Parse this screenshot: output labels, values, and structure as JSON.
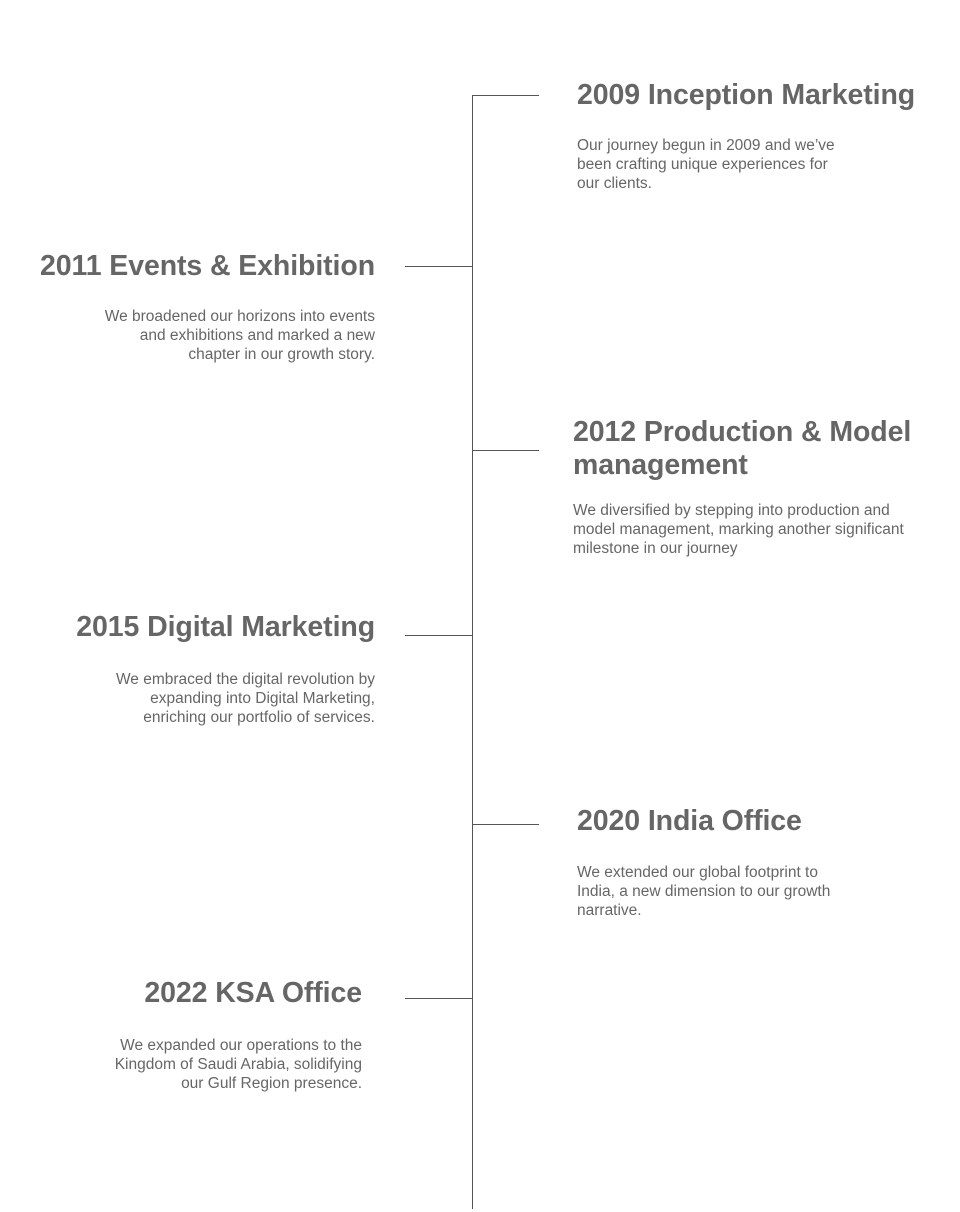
{
  "timeline": {
    "milestones": [
      {
        "title": "2009 Inception Marketing",
        "description": "Our journey begun in 2009 and we’ve been crafting unique experiences for our clients."
      },
      {
        "title": "2011 Events & Exhibition",
        "description": "We broadened our horizons into events and exhibitions and marked a new chapter in our growth story."
      },
      {
        "title": "2012 Production & Model management",
        "description": "We diversified by stepping into production and model management, marking another significant milestone in our journey"
      },
      {
        "title": "2015 Digital Marketing",
        "description": "We embraced the digital revolution by expanding into Digital Marketing, enriching our portfolio of services."
      },
      {
        "title": "2020 India Office",
        "description": "We extended our global footprint to India, a new dimension to our growth narrative."
      },
      {
        "title": "2022 KSA Office",
        "description": "We expanded our operations to the Kingdom of Saudi Arabia, solidifying our Gulf Region presence."
      }
    ]
  },
  "colors": {
    "text": "#666666",
    "line": "#555555",
    "background": "#ffffff"
  }
}
